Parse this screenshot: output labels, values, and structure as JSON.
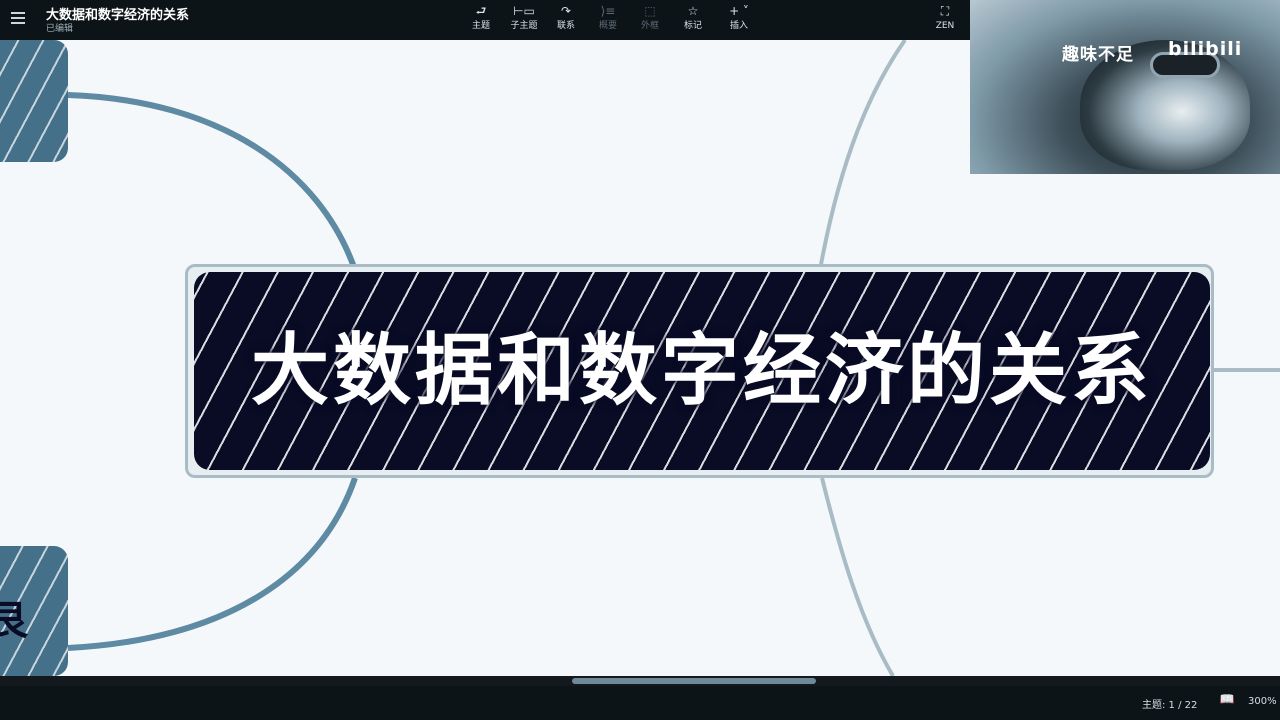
{
  "document": {
    "title": "大数据和数字经济的关系",
    "status": "已编辑"
  },
  "toolbar": {
    "items": [
      {
        "label": "主题",
        "icon": "topic-icon"
      },
      {
        "label": "子主题",
        "icon": "subtopic-icon"
      },
      {
        "label": "联系",
        "icon": "relationship-icon"
      },
      {
        "label": "概要",
        "icon": "summary-icon"
      },
      {
        "label": "外框",
        "icon": "boundary-icon"
      },
      {
        "label": "标记",
        "icon": "star-icon"
      },
      {
        "label": "插入",
        "icon": "plus-icon"
      }
    ],
    "zen_label": "ZEN"
  },
  "canvas": {
    "central_topic": "大数据和数字经济的关系",
    "left_bottom_node_glyph": "艮"
  },
  "webcam": {
    "caption": "趣味不足",
    "logo": "bilibili"
  },
  "status_bar": {
    "topic_count": "主题: 1 / 22",
    "zoom": "300%"
  },
  "colors": {
    "central_bg": "#0a0c26",
    "branch_line": "#5e8aa3",
    "side_node": "#45708a",
    "toolbar_bg": "#0d1418"
  }
}
